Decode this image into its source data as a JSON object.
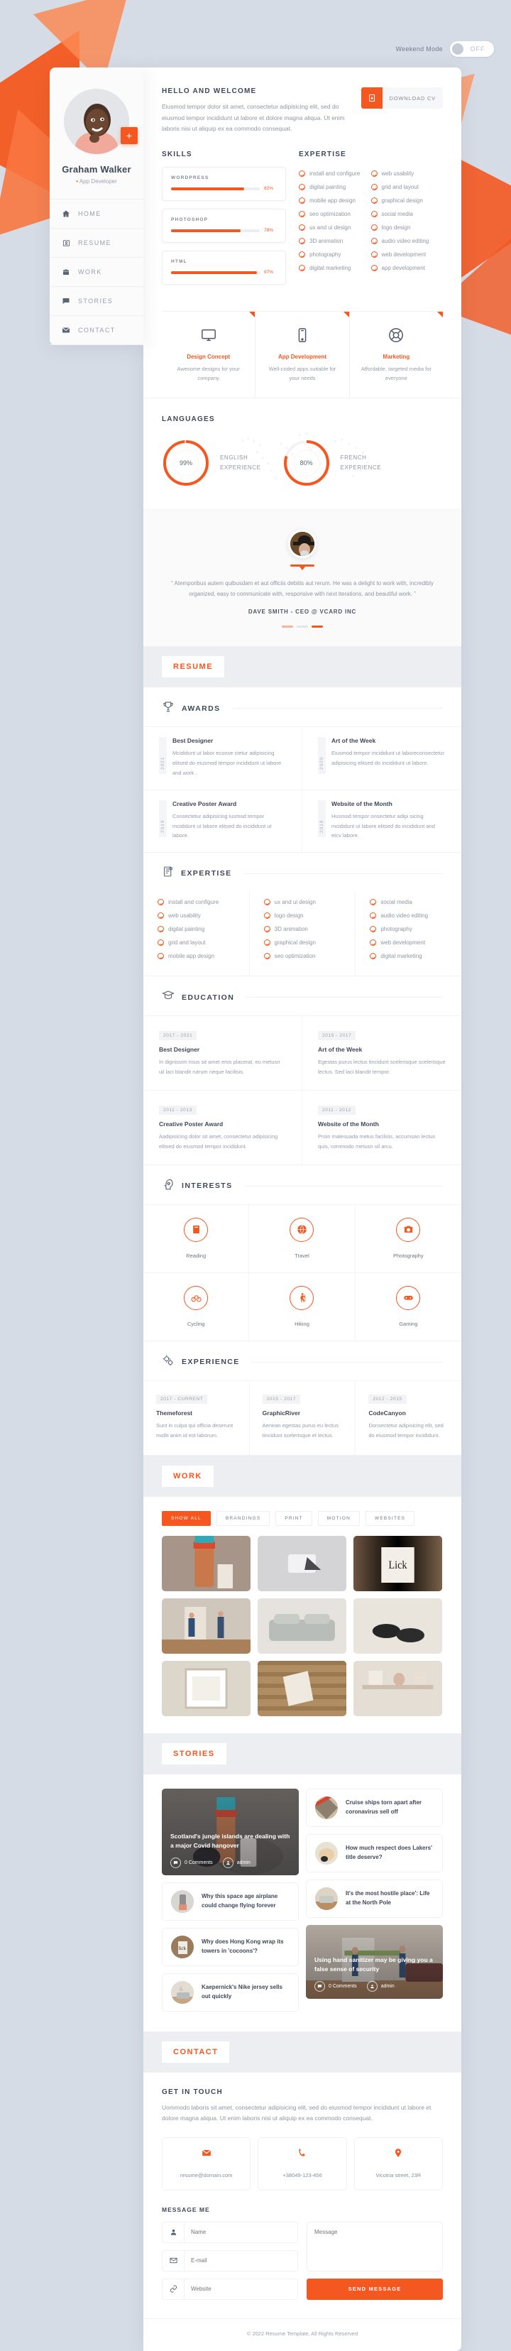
{
  "topbar": {
    "weekend_mode_label": "Weekend Mode",
    "toggle_state": "OFF"
  },
  "sidebar": {
    "name": "Graham Walker",
    "role": "App Developer",
    "add_button": "+",
    "items": [
      {
        "label": "HOME",
        "icon": "home-icon"
      },
      {
        "label": "RESUME",
        "icon": "resume-icon"
      },
      {
        "label": "WORK",
        "icon": "briefcase-icon"
      },
      {
        "label": "STORIES",
        "icon": "chat-icon"
      },
      {
        "label": "CONTACT",
        "icon": "envelope-icon"
      }
    ]
  },
  "intro": {
    "title": "HELLO AND WELCOME",
    "text": "Eiusmod tempor dolor sit amet, consectetur adipisicing elit, sed do eiusmod tempor incididunt ut labore et dolore magna aliqua. Ut enim laboris nisi ut aliquip ex ea commodo consequat.",
    "download_label": "DOWNLOAD CV"
  },
  "skills": {
    "title": "SKILLS",
    "items": [
      {
        "name": "WORDPRESS",
        "percent": 82,
        "percent_label": "82%"
      },
      {
        "name": "PHOTOSHOP",
        "percent": 78,
        "percent_label": "78%"
      },
      {
        "name": "HTML",
        "percent": 97,
        "percent_label": "97%"
      }
    ]
  },
  "expertise_home": {
    "title": "EXPERTISE",
    "items": [
      "install and configure",
      "web usability",
      "digital painting",
      "grid and layout",
      "mobile app design",
      "graphical design",
      "seo optimization",
      "social media",
      "ux and ui design",
      "logo design",
      "3D animation",
      "audio video editing",
      "photography",
      "web development",
      "digital marketing",
      "app development"
    ]
  },
  "services": [
    {
      "icon": "monitor-icon",
      "title": "Design Concept",
      "text": "Awesome designs for your company"
    },
    {
      "icon": "mobile-icon",
      "title": "App Development",
      "text": "Well-coded apps suitable for your needs"
    },
    {
      "icon": "lifebuoy-icon",
      "title": "Marketing",
      "text": "Affordable, targeted media for everyone"
    }
  ],
  "languages": {
    "title": "LANGUAGES",
    "items": [
      {
        "percent": 99,
        "percent_label": "99%",
        "line1": "ENGLISH",
        "line2": "EXPERIENCE"
      },
      {
        "percent": 80,
        "percent_label": "80%",
        "line1": "FRENCH",
        "line2": "EXPERIENCE"
      }
    ]
  },
  "testimonial": {
    "text": "“ Atemporibus autem quibusdam et aut officiis debitis aut rerum. He was a delight to work with, incredibly organized, easy to communicate with, responsive with next iterations, and beautiful work. ”",
    "author": "DAVE SMITH - CEO @ VCARD INC"
  },
  "resume": {
    "ribbon": "RESUME",
    "awards": {
      "title": "AWARDS",
      "items": [
        {
          "year": "2021",
          "title": "Best Designer",
          "text": "Mcididunt ut labor econse ctetur adipisicing elitsed do eiusmod tempor incididunt ut labore and work ."
        },
        {
          "year": "2020",
          "title": "Art of the Week",
          "text": "Eiusmod tempor mcididunt ut laboreconsectetur adipisicing elitsed do incididunt ut labore."
        },
        {
          "year": "2019",
          "title": "Creative Poster Award",
          "text": "Consectetur adipisicing iusmod tempor mcididunt ut labore elitsed do incididunt ut labore."
        },
        {
          "year": "2018",
          "title": "Website of the Month",
          "text": "Husmod tempor onsectetur adipi sicing mcididunt ut labore elitsed do incididunt and etcv labore."
        }
      ]
    },
    "expertise": {
      "title": "EXPERTISE",
      "columns": [
        [
          "install and configure",
          "web usability",
          "digital painting",
          "grid and layout",
          "mobile app design"
        ],
        [
          "ux and ui design",
          "logo design",
          "3D animation",
          "graphical design",
          "seo optimization"
        ],
        [
          "social media",
          "audio video editing",
          "photography",
          "web development",
          "digital marketing"
        ]
      ]
    },
    "education": {
      "title": "EDUCATION",
      "items": [
        {
          "years": "2017 - 2021",
          "title": "Best Designer",
          "text": "In dignissim risus sit amet eros placerat, eu metusn uil laci blandit rutrum neque facilisis."
        },
        {
          "years": "2015 - 2017",
          "title": "Art of the Week",
          "text": "Egestas purus lectus tincidunt scelerisque scelerisque lectus. Sed laci blandit tempor."
        },
        {
          "years": "2011 - 2013",
          "title": "Creative Poster Award",
          "text": "Aadipisicing dolor sit amet, consectetur adipisicing elitsed do eiusmod tempor incididunt."
        },
        {
          "years": "2011 - 2012",
          "title": "Website of the Month",
          "text": "Proin malesuada metus facilisis, accumsan lectus quis, commodo metusn uil arcu."
        }
      ]
    },
    "interests": {
      "title": "INTERESTS",
      "items": [
        {
          "icon": "book-icon",
          "label": "Reading"
        },
        {
          "icon": "globe-icon",
          "label": "Travel"
        },
        {
          "icon": "camera-icon",
          "label": "Photography"
        },
        {
          "icon": "bicycle-icon",
          "label": "Cycling"
        },
        {
          "icon": "hiking-icon",
          "label": "Hiking"
        },
        {
          "icon": "gamepad-icon",
          "label": "Gaming"
        }
      ]
    },
    "experience": {
      "title": "EXPERIENCE",
      "items": [
        {
          "years": "2017 - CURRENT",
          "title": "Themeforest",
          "text": "Sunt in culpa qui officia deserunt mollit anim id est laborum."
        },
        {
          "years": "2015 - 2017",
          "title": "GraphicRiver",
          "text": "Aenean egestas purus eu lectus tincidunt scelerisque et lectus."
        },
        {
          "years": "2012 - 2015",
          "title": "CodeCanyon",
          "text": "Donsectetur adipisicing elit, sed do eiusmod tempor incididunt."
        }
      ]
    }
  },
  "work": {
    "ribbon": "WORK",
    "filters": [
      "SHOW ALL",
      "BRANDINGS",
      "PRINT",
      "MOTION",
      "WEBSITES"
    ],
    "active_filter": "SHOW ALL",
    "items": [
      {
        "name": "bottle-mockup"
      },
      {
        "name": "grey-device"
      },
      {
        "name": "lick-poster"
      },
      {
        "name": "interior-people"
      },
      {
        "name": "grey-sofa"
      },
      {
        "name": "black-shoes"
      },
      {
        "name": "frame-mockup"
      },
      {
        "name": "wood-floor"
      },
      {
        "name": "shelf-decor"
      }
    ]
  },
  "stories": {
    "ribbon": "STORIES",
    "featured": [
      {
        "title": "Scotland's jungle islands are dealing with a major Covid hangover",
        "comments": "0 Comments",
        "author": "admin"
      },
      {
        "title": "Using hand sanitizer may be giving you a false sense of security",
        "comments": "0 Comments",
        "author": "admin"
      }
    ],
    "list_left": [
      {
        "title": "Why this space age airplane could change flying forever"
      },
      {
        "title": "Why does Hong Kong wrap its towers in 'cocoons'?"
      },
      {
        "title": "Kaepernick's Nike jersey sells out quickly"
      }
    ],
    "list_right": [
      {
        "title": "Cruise ships torn apart after coronavirus sell off"
      },
      {
        "title": "How much respect does Lakers' title deserve?"
      },
      {
        "title": "It's the most hostile place': Life at the North Pole"
      }
    ]
  },
  "contact": {
    "ribbon": "CONTACT",
    "title": "GET IN TOUCH",
    "text": "Uommodo laboris sit amet, consectetur adipisicing elit, sed do eiusmod tempor incididunt ut labore et dolore magna aliqua. Ut enim laboris nisi ut aliquip ex ea commodo consequat.",
    "cards": [
      {
        "icon": "envelope-icon",
        "value": "resume@domain.com"
      },
      {
        "icon": "phone-icon",
        "value": "+38049-123-456"
      },
      {
        "icon": "pin-icon",
        "value": "Vicotria street, 23R"
      }
    ],
    "form_title": "MESSAGE ME",
    "name_placeholder": "Name",
    "email_placeholder": "E-mail",
    "website_placeholder": "Website",
    "message_placeholder": "Message",
    "send_label": "SEND MESSAGE"
  },
  "footer": {
    "copyright": "© 2022 Resume Template, All Rights Reserved"
  },
  "colors": {
    "accent": "#f4571f",
    "bg": "#d6dce5",
    "text_dark": "#3d4857",
    "text_muted": "#949dab"
  }
}
